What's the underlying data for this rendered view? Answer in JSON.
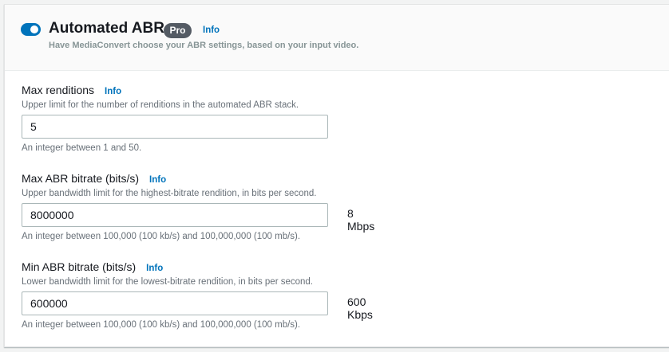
{
  "header": {
    "toggle_on": true,
    "title": "Automated ABR",
    "badge": "Pro",
    "info": "Info",
    "subtitle": "Have MediaConvert choose your ABR settings, based on your input video."
  },
  "fields": [
    {
      "label": "Max renditions",
      "info": "Info",
      "description": "Upper limit for the number of renditions in the automated ABR stack.",
      "value": "5",
      "hint": "An integer between 1 and 50.",
      "suffix": ""
    },
    {
      "label": "Max ABR bitrate (bits/s)",
      "info": "Info",
      "description": "Upper bandwidth limit for the highest-bitrate rendition, in bits per second.",
      "value": "8000000",
      "hint": "An integer between 100,000 (100 kb/s) and 100,000,000 (100 mb/s).",
      "suffix": "8 Mbps"
    },
    {
      "label": "Min ABR bitrate (bits/s)",
      "info": "Info",
      "description": "Lower bandwidth limit for the lowest-bitrate rendition, in bits per second.",
      "value": "600000",
      "hint": "An integer between 100,000 (100 kb/s) and 100,000,000 (100 mb/s).",
      "suffix": "600 Kbps"
    }
  ]
}
